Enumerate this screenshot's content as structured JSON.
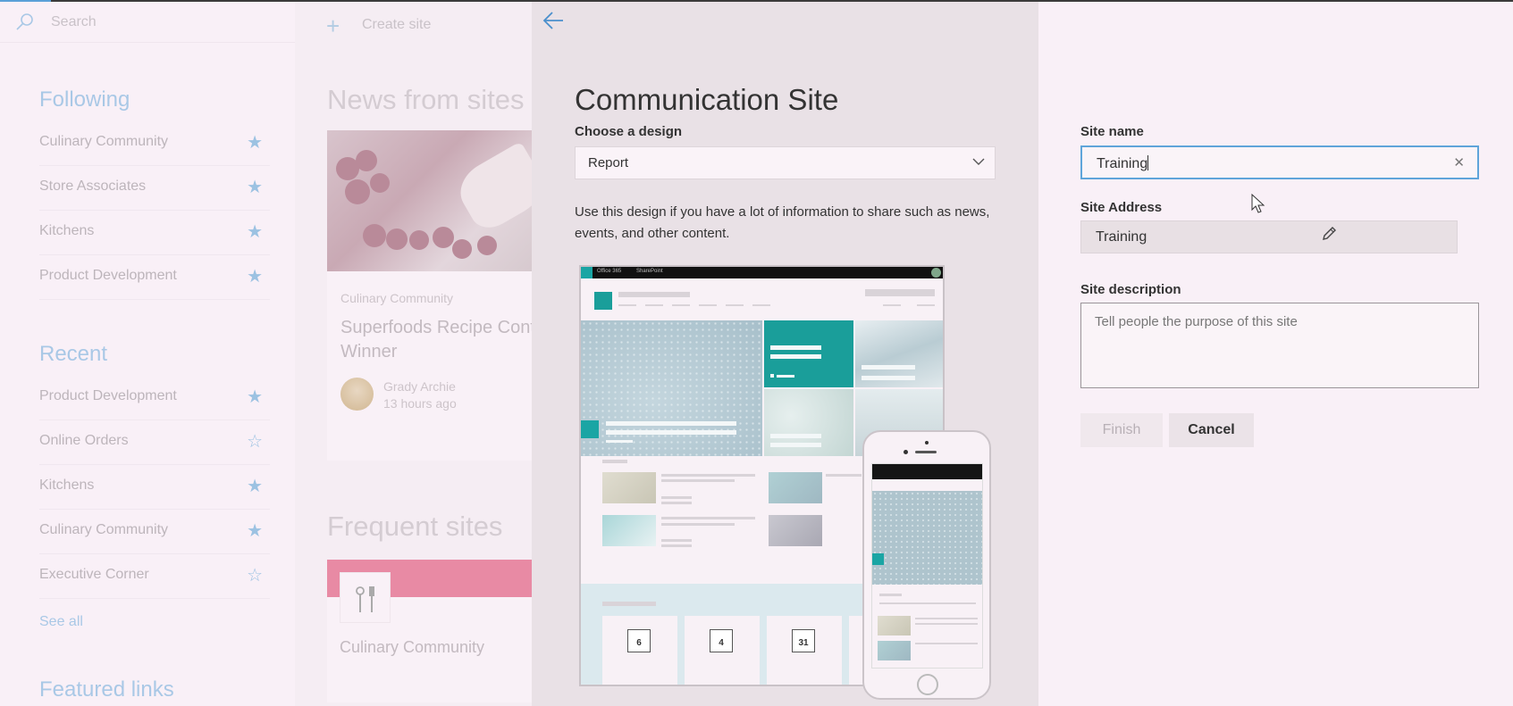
{
  "sidebar": {
    "search_placeholder": "Search",
    "following": {
      "title": "Following",
      "items": [
        {
          "label": "Culinary Community",
          "starred": true
        },
        {
          "label": "Store Associates",
          "starred": true
        },
        {
          "label": "Kitchens",
          "starred": true
        },
        {
          "label": "Product Development",
          "starred": true
        }
      ]
    },
    "recent": {
      "title": "Recent",
      "items": [
        {
          "label": "Product Development",
          "starred": true
        },
        {
          "label": "Online Orders",
          "starred": false
        },
        {
          "label": "Kitchens",
          "starred": true
        },
        {
          "label": "Culinary Community",
          "starred": true
        },
        {
          "label": "Executive Corner",
          "starred": false
        }
      ]
    },
    "see_all": "See all",
    "featured_title": "Featured links"
  },
  "middle": {
    "create_site": "Create site",
    "news_title": "News from sites",
    "news": {
      "site": "Culinary Community",
      "title": "Superfoods Recipe Contest Winner",
      "author": "Grady Archie",
      "time": "13 hours ago"
    },
    "frequent_title": "Frequent sites",
    "frequent": {
      "name": "Culinary Community",
      "color": "#e88aa4"
    }
  },
  "panel": {
    "title": "Communication Site",
    "design_label": "Choose a design",
    "design_value": "Report",
    "description": "Use this design if you have a lot of information to share such as news, events, and other content.",
    "preview": {
      "bar_app": "Office 365",
      "bar_product": "SharePoint",
      "event_dates": [
        "6",
        "4",
        "31"
      ],
      "accent": "#1a9e9a"
    }
  },
  "form": {
    "site_name_label": "Site name",
    "site_name_value": "Training",
    "site_address_label": "Site Address",
    "site_address_value": "Training",
    "site_description_label": "Site description",
    "site_description_placeholder": "Tell people the purpose of this site",
    "finish_label": "Finish",
    "cancel_label": "Cancel"
  }
}
